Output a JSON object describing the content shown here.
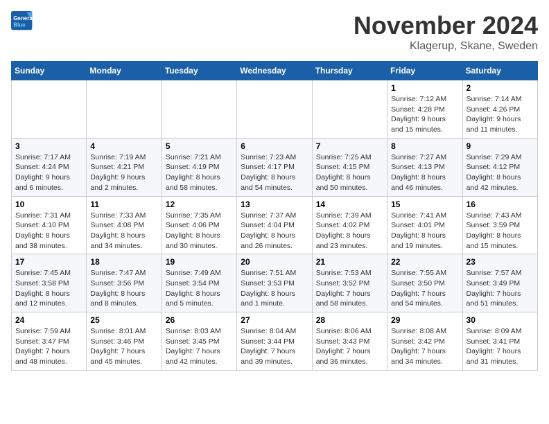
{
  "logo": {
    "text_general": "General",
    "text_blue": "Blue"
  },
  "header": {
    "month_year": "November 2024",
    "location": "Klagerup, Skane, Sweden"
  },
  "weekdays": [
    "Sunday",
    "Monday",
    "Tuesday",
    "Wednesday",
    "Thursday",
    "Friday",
    "Saturday"
  ],
  "weeks": [
    [
      {
        "day": "",
        "info": ""
      },
      {
        "day": "",
        "info": ""
      },
      {
        "day": "",
        "info": ""
      },
      {
        "day": "",
        "info": ""
      },
      {
        "day": "",
        "info": ""
      },
      {
        "day": "1",
        "info": "Sunrise: 7:12 AM\nSunset: 4:28 PM\nDaylight: 9 hours and 15 minutes."
      },
      {
        "day": "2",
        "info": "Sunrise: 7:14 AM\nSunset: 4:26 PM\nDaylight: 9 hours and 11 minutes."
      }
    ],
    [
      {
        "day": "3",
        "info": "Sunrise: 7:17 AM\nSunset: 4:24 PM\nDaylight: 9 hours and 6 minutes."
      },
      {
        "day": "4",
        "info": "Sunrise: 7:19 AM\nSunset: 4:21 PM\nDaylight: 9 hours and 2 minutes."
      },
      {
        "day": "5",
        "info": "Sunrise: 7:21 AM\nSunset: 4:19 PM\nDaylight: 8 hours and 58 minutes."
      },
      {
        "day": "6",
        "info": "Sunrise: 7:23 AM\nSunset: 4:17 PM\nDaylight: 8 hours and 54 minutes."
      },
      {
        "day": "7",
        "info": "Sunrise: 7:25 AM\nSunset: 4:15 PM\nDaylight: 8 hours and 50 minutes."
      },
      {
        "day": "8",
        "info": "Sunrise: 7:27 AM\nSunset: 4:13 PM\nDaylight: 8 hours and 46 minutes."
      },
      {
        "day": "9",
        "info": "Sunrise: 7:29 AM\nSunset: 4:12 PM\nDaylight: 8 hours and 42 minutes."
      }
    ],
    [
      {
        "day": "10",
        "info": "Sunrise: 7:31 AM\nSunset: 4:10 PM\nDaylight: 8 hours and 38 minutes."
      },
      {
        "day": "11",
        "info": "Sunrise: 7:33 AM\nSunset: 4:08 PM\nDaylight: 8 hours and 34 minutes."
      },
      {
        "day": "12",
        "info": "Sunrise: 7:35 AM\nSunset: 4:06 PM\nDaylight: 8 hours and 30 minutes."
      },
      {
        "day": "13",
        "info": "Sunrise: 7:37 AM\nSunset: 4:04 PM\nDaylight: 8 hours and 26 minutes."
      },
      {
        "day": "14",
        "info": "Sunrise: 7:39 AM\nSunset: 4:02 PM\nDaylight: 8 hours and 23 minutes."
      },
      {
        "day": "15",
        "info": "Sunrise: 7:41 AM\nSunset: 4:01 PM\nDaylight: 8 hours and 19 minutes."
      },
      {
        "day": "16",
        "info": "Sunrise: 7:43 AM\nSunset: 3:59 PM\nDaylight: 8 hours and 15 minutes."
      }
    ],
    [
      {
        "day": "17",
        "info": "Sunrise: 7:45 AM\nSunset: 3:58 PM\nDaylight: 8 hours and 12 minutes."
      },
      {
        "day": "18",
        "info": "Sunrise: 7:47 AM\nSunset: 3:56 PM\nDaylight: 8 hours and 8 minutes."
      },
      {
        "day": "19",
        "info": "Sunrise: 7:49 AM\nSunset: 3:54 PM\nDaylight: 8 hours and 5 minutes."
      },
      {
        "day": "20",
        "info": "Sunrise: 7:51 AM\nSunset: 3:53 PM\nDaylight: 8 hours and 1 minute."
      },
      {
        "day": "21",
        "info": "Sunrise: 7:53 AM\nSunset: 3:52 PM\nDaylight: 7 hours and 58 minutes."
      },
      {
        "day": "22",
        "info": "Sunrise: 7:55 AM\nSunset: 3:50 PM\nDaylight: 7 hours and 54 minutes."
      },
      {
        "day": "23",
        "info": "Sunrise: 7:57 AM\nSunset: 3:49 PM\nDaylight: 7 hours and 51 minutes."
      }
    ],
    [
      {
        "day": "24",
        "info": "Sunrise: 7:59 AM\nSunset: 3:47 PM\nDaylight: 7 hours and 48 minutes."
      },
      {
        "day": "25",
        "info": "Sunrise: 8:01 AM\nSunset: 3:46 PM\nDaylight: 7 hours and 45 minutes."
      },
      {
        "day": "26",
        "info": "Sunrise: 8:03 AM\nSunset: 3:45 PM\nDaylight: 7 hours and 42 minutes."
      },
      {
        "day": "27",
        "info": "Sunrise: 8:04 AM\nSunset: 3:44 PM\nDaylight: 7 hours and 39 minutes."
      },
      {
        "day": "28",
        "info": "Sunrise: 8:06 AM\nSunset: 3:43 PM\nDaylight: 7 hours and 36 minutes."
      },
      {
        "day": "29",
        "info": "Sunrise: 8:08 AM\nSunset: 3:42 PM\nDaylight: 7 hours and 34 minutes."
      },
      {
        "day": "30",
        "info": "Sunrise: 8:09 AM\nSunset: 3:41 PM\nDaylight: 7 hours and 31 minutes."
      }
    ]
  ]
}
